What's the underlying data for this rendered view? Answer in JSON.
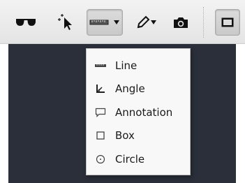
{
  "toolbar": {
    "tools": [
      {
        "icon": "glasses-icon"
      },
      {
        "icon": "select-pointer-icon"
      },
      {
        "icon": "ruler-measure-icon",
        "has_dropdown": true,
        "pressed": true
      },
      {
        "icon": "pen-annotate-icon",
        "has_dropdown": true
      },
      {
        "icon": "camera-icon"
      },
      {
        "icon": "window-layout-icon",
        "pressed": true
      }
    ]
  },
  "measure_menu": {
    "items": [
      {
        "label": "Line",
        "icon": "line-icon"
      },
      {
        "label": "Angle",
        "icon": "angle-icon"
      },
      {
        "label": "Annotation",
        "icon": "annotation-icon"
      },
      {
        "label": "Box",
        "icon": "box-icon"
      },
      {
        "label": "Circle",
        "icon": "circle-icon"
      }
    ]
  },
  "colors": {
    "toolbar_bg": "#e8e8e8",
    "viewport_bg": "#2b2f3a",
    "menu_bg": "#f8f8f8"
  }
}
